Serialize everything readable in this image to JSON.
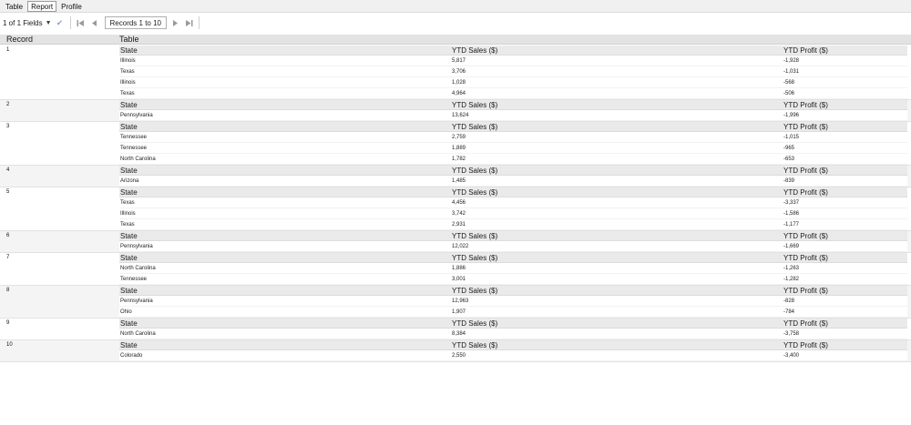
{
  "tabs": [
    {
      "label": "Table",
      "active": false
    },
    {
      "label": "Report",
      "active": true
    },
    {
      "label": "Profile",
      "active": false
    }
  ],
  "toolbar": {
    "fields_label": "1 of 1 Fields",
    "records_label": "Records 1 to 10"
  },
  "grid_header": {
    "record": "Record",
    "table": "Table"
  },
  "inner_columns": [
    "State",
    "YTD Sales ($)",
    "YTD Profit ($)"
  ],
  "records": [
    {
      "num": "1",
      "rows": [
        [
          "Illinois",
          "5,817",
          "-1,928"
        ],
        [
          "Texas",
          "3,706",
          "-1,031"
        ],
        [
          "Illinois",
          "1,028",
          "-568"
        ],
        [
          "Texas",
          "4,964",
          "-506"
        ]
      ]
    },
    {
      "num": "2",
      "rows": [
        [
          "Pennsylvania",
          "13,624",
          "-1,996"
        ]
      ]
    },
    {
      "num": "3",
      "rows": [
        [
          "Tennessee",
          "2,759",
          "-1,015"
        ],
        [
          "Tennessee",
          "1,889",
          "-965"
        ],
        [
          "North Carolina",
          "1,782",
          "-653"
        ]
      ]
    },
    {
      "num": "4",
      "rows": [
        [
          "Arizona",
          "1,485",
          "-839"
        ]
      ]
    },
    {
      "num": "5",
      "rows": [
        [
          "Texas",
          "4,456",
          "-3,337"
        ],
        [
          "Illinois",
          "3,742",
          "-1,586"
        ],
        [
          "Texas",
          "2,931",
          "-1,177"
        ]
      ]
    },
    {
      "num": "6",
      "rows": [
        [
          "Pennsylvania",
          "12,022",
          "-1,669"
        ]
      ]
    },
    {
      "num": "7",
      "rows": [
        [
          "North Carolina",
          "1,886",
          "-1,263"
        ],
        [
          "Tennessee",
          "3,001",
          "-1,282"
        ]
      ]
    },
    {
      "num": "8",
      "rows": [
        [
          "Pennsylvania",
          "12,963",
          "-828"
        ],
        [
          "Ohio",
          "1,907",
          "-784"
        ]
      ]
    },
    {
      "num": "9",
      "rows": [
        [
          "North Carolina",
          "8,384",
          "-3,758"
        ]
      ]
    },
    {
      "num": "10",
      "rows": [
        [
          "Colorado",
          "2,550",
          "-3,400"
        ]
      ]
    }
  ]
}
